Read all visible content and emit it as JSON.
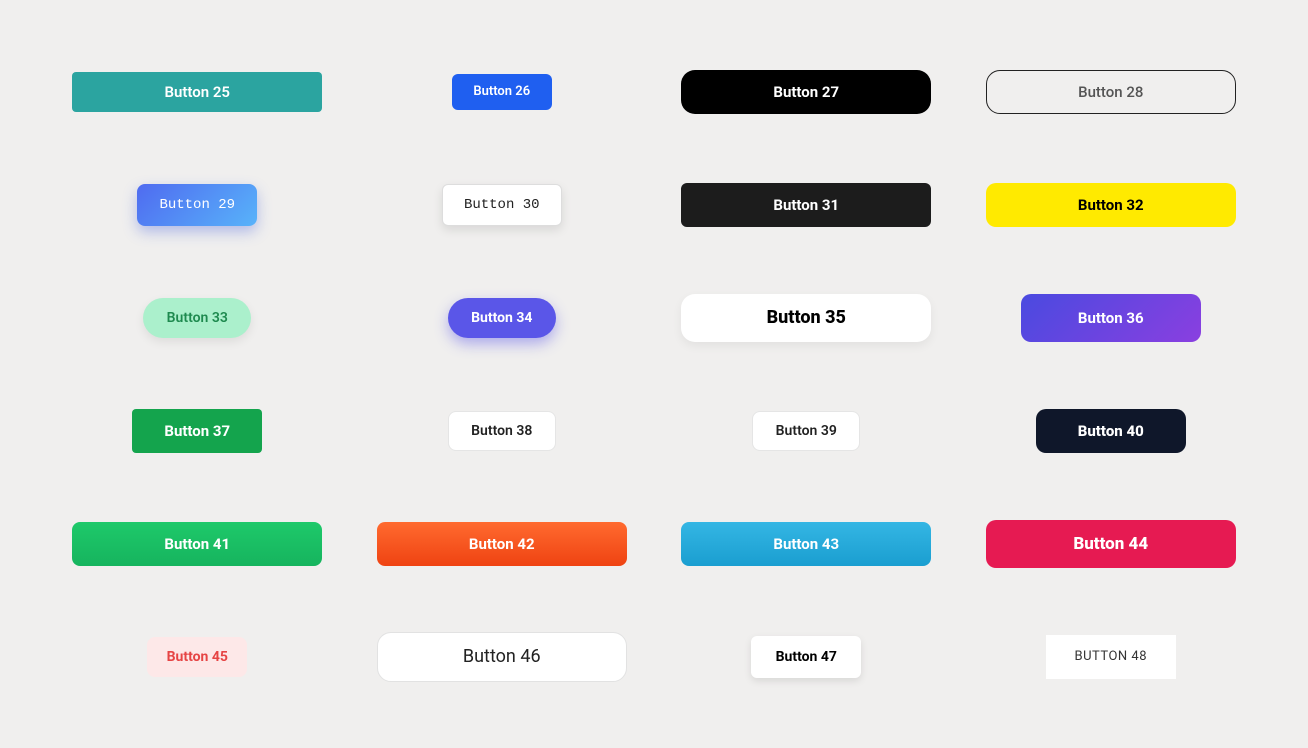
{
  "buttons": {
    "b25": "Button 25",
    "b26": "Button 26",
    "b27": "Button 27",
    "b28": "Button 28",
    "b29": "Button 29",
    "b30": "Button 30",
    "b31": "Button 31",
    "b32": "Button 32",
    "b33": "Button 33",
    "b34": "Button 34",
    "b35": "Button 35",
    "b36": "Button 36",
    "b37": "Button 37",
    "b38": "Button 38",
    "b39": "Button 39",
    "b40": "Button 40",
    "b41": "Button 41",
    "b42": "Button 42",
    "b43": "Button 43",
    "b44": "Button 44",
    "b45": "Button 45",
    "b46": "Button 46",
    "b47": "Button 47",
    "b48": "BUTTON 48"
  }
}
